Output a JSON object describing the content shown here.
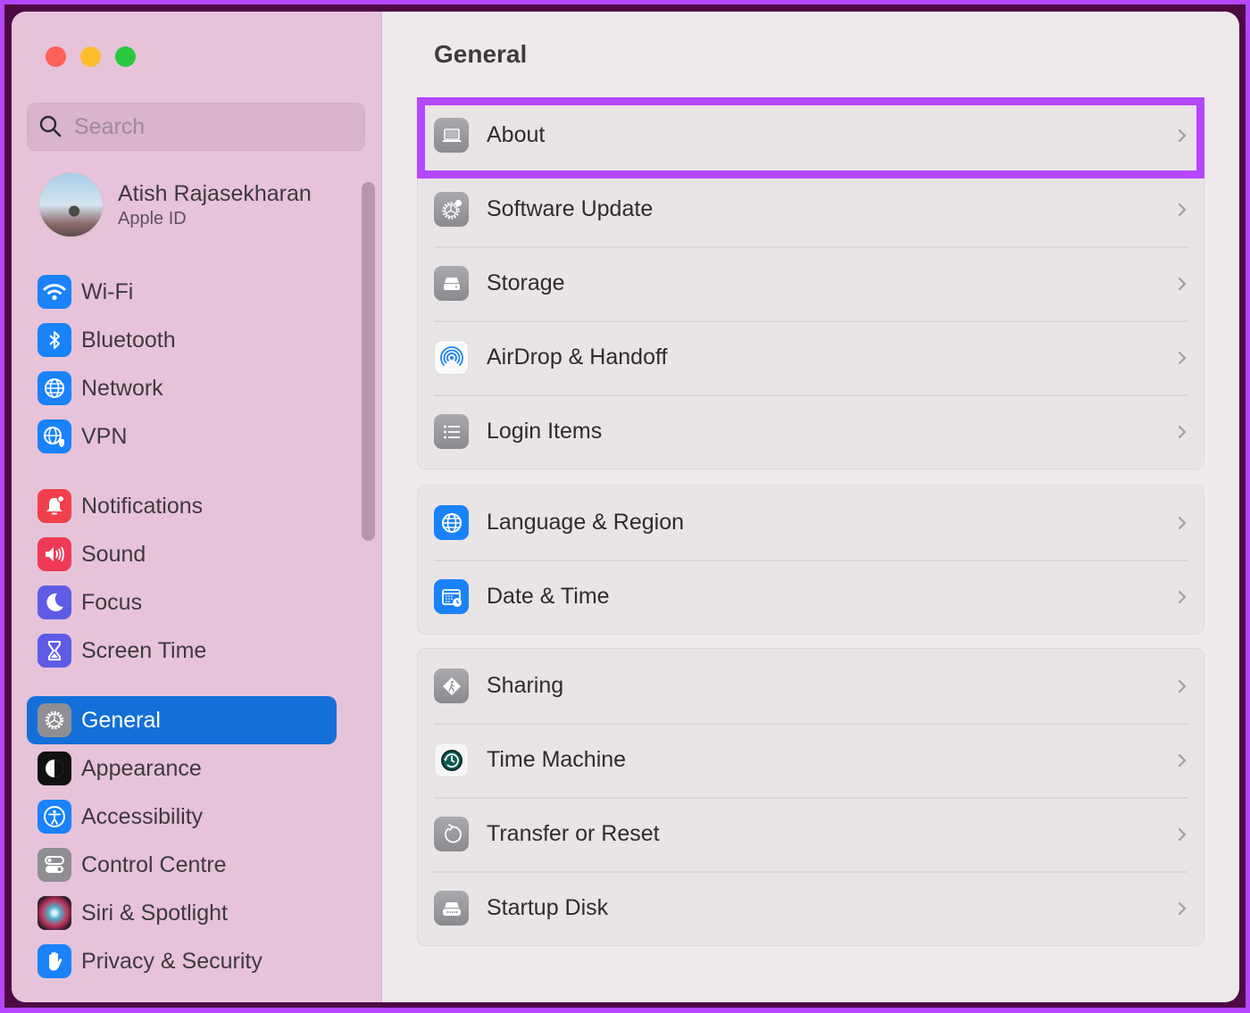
{
  "window": {
    "traffic_lights": [
      "close",
      "minimize",
      "maximize"
    ]
  },
  "sidebar": {
    "search": {
      "placeholder": "Search",
      "value": ""
    },
    "profile": {
      "name": "Atish Rajasekharan",
      "subtitle": "Apple ID"
    },
    "groups": [
      [
        {
          "label": "Wi-Fi",
          "icon": "wifi-icon",
          "color": "#1a82fb"
        },
        {
          "label": "Bluetooth",
          "icon": "bluetooth-icon",
          "color": "#1a82fb"
        },
        {
          "label": "Network",
          "icon": "globe-icon",
          "color": "#1a82fb"
        },
        {
          "label": "VPN",
          "icon": "vpn-globe-shield-icon",
          "color": "#1a82fb"
        }
      ],
      [
        {
          "label": "Notifications",
          "icon": "bell-icon",
          "color": "#f1404b"
        },
        {
          "label": "Sound",
          "icon": "speaker-icon",
          "color": "#f03a55"
        },
        {
          "label": "Focus",
          "icon": "moon-icon",
          "color": "#5e5ce6"
        },
        {
          "label": "Screen Time",
          "icon": "hourglass-icon",
          "color": "#5e5ce6"
        }
      ],
      [
        {
          "label": "General",
          "icon": "gear-icon",
          "color": "#8e8e93",
          "active": true
        },
        {
          "label": "Appearance",
          "icon": "appearance-icon",
          "color": "#111111"
        },
        {
          "label": "Accessibility",
          "icon": "accessibility-icon",
          "color": "#1a82fb"
        },
        {
          "label": "Control Centre",
          "icon": "toggles-icon",
          "color": "#8e8e93"
        },
        {
          "label": "Siri & Spotlight",
          "icon": "siri-icon",
          "color": "#3a1f3a"
        },
        {
          "label": "Privacy & Security",
          "icon": "hand-icon",
          "color": "#1a82fb"
        }
      ]
    ]
  },
  "main": {
    "title": "General",
    "highlight_color": "#b447ff",
    "groups": [
      [
        {
          "label": "About",
          "icon": "laptop-icon",
          "highlighted": true
        },
        {
          "label": "Software Update",
          "icon": "gear-badge-icon"
        },
        {
          "label": "Storage",
          "icon": "drive-icon"
        },
        {
          "label": "AirDrop & Handoff",
          "icon": "airdrop-icon"
        },
        {
          "label": "Login Items",
          "icon": "list-icon"
        }
      ],
      [
        {
          "label": "Language & Region",
          "icon": "globe-icon"
        },
        {
          "label": "Date & Time",
          "icon": "calendar-clock-icon"
        }
      ],
      [
        {
          "label": "Sharing",
          "icon": "sharing-icon"
        },
        {
          "label": "Time Machine",
          "icon": "time-machine-icon"
        },
        {
          "label": "Transfer or Reset",
          "icon": "reset-icon"
        },
        {
          "label": "Startup Disk",
          "icon": "startup-disk-icon"
        }
      ]
    ]
  }
}
